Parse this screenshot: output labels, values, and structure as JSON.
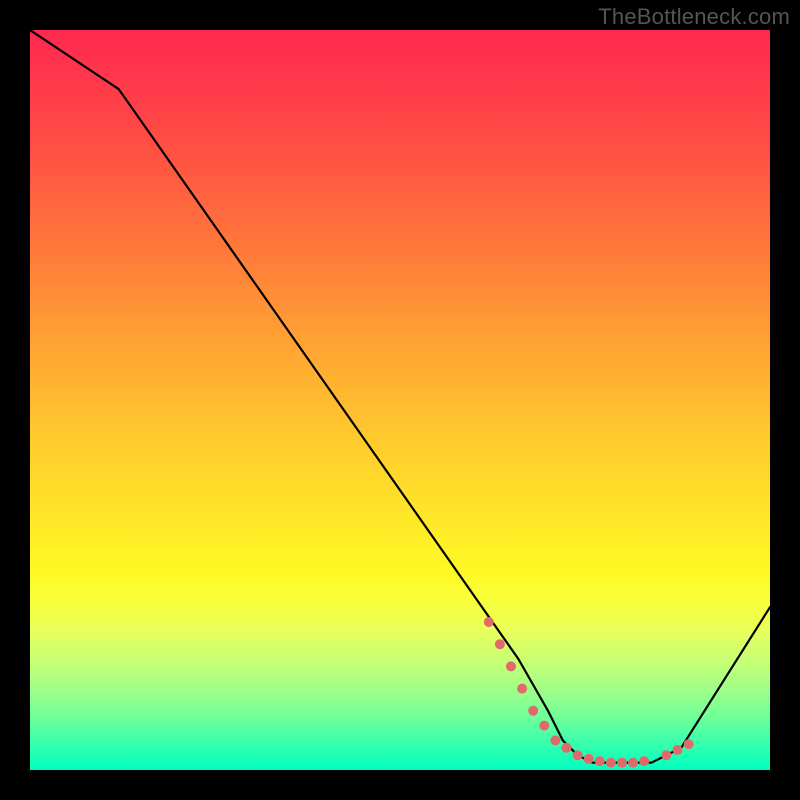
{
  "watermark": "TheBottleneck.com",
  "chart_data": {
    "type": "line",
    "title": "",
    "xlabel": "",
    "ylabel": "",
    "xlim": [
      0,
      100
    ],
    "ylim": [
      0,
      100
    ],
    "series": [
      {
        "name": "bottleneck-curve",
        "x": [
          0,
          12,
          66,
          70,
          72,
          74,
          76,
          78,
          80,
          82,
          84,
          86,
          88,
          100
        ],
        "y": [
          100,
          92,
          15,
          8,
          4,
          2,
          1,
          1,
          1,
          1,
          1,
          2,
          3,
          22
        ]
      }
    ],
    "data_points": {
      "name": "highlighted-dots",
      "x": [
        62,
        63.5,
        65,
        66.5,
        68,
        69.5,
        71,
        72.5,
        74,
        75.5,
        77,
        78.5,
        80,
        81.5,
        83,
        86,
        87.5,
        89
      ],
      "y": [
        20,
        17,
        14,
        11,
        8,
        6,
        4,
        3,
        2,
        1.5,
        1.2,
        1,
        1,
        1,
        1.2,
        2,
        2.7,
        3.5
      ]
    },
    "background": {
      "top_color": "#ff2850",
      "mid_color": "#ffe728",
      "bottom_color": "#00ffc0"
    }
  }
}
